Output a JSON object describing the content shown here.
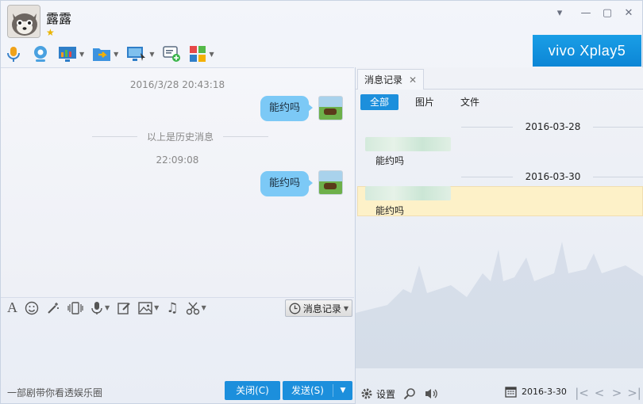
{
  "header": {
    "nickname": "露露",
    "vip_icon": "star-icon",
    "window_controls": [
      "dropdown",
      "minimize",
      "maximize",
      "close"
    ],
    "toolbar": [
      "voice-call-icon",
      "video-call-icon",
      "screen-share-icon",
      "file-transfer-icon",
      "remote-assist-icon",
      "create-group-icon",
      "apps-icon"
    ],
    "ad_text": "vivo Xplay5"
  },
  "chat": {
    "timestamp1": "2016/3/28 20:43:18",
    "msg1": "能约吗",
    "history_separator": "以上是历史消息",
    "timestamp2": "22:09:08",
    "msg2": "能约吗"
  },
  "input": {
    "tools": [
      "font-icon",
      "emoji-icon",
      "magic-icon",
      "shake-icon",
      "voice-msg-icon",
      "edit-icon",
      "image-icon",
      "music-icon",
      "screenshot-icon"
    ],
    "message_record_label": "消息记录",
    "promo_text": "一部剧带你看透娱乐圈",
    "close_label": "关闭(C)",
    "send_label": "发送(S)"
  },
  "history_panel": {
    "tab_title": "消息记录",
    "filters": [
      "全部",
      "图片",
      "文件"
    ],
    "groups": [
      {
        "date": "2016-03-28",
        "text": "能约吗"
      },
      {
        "date": "2016-03-30",
        "text": "能约吗"
      }
    ],
    "settings_label": "设置",
    "date_value": "2016-3-30",
    "accent": "#1c8fdc",
    "highlight": "#fdf1c8"
  }
}
